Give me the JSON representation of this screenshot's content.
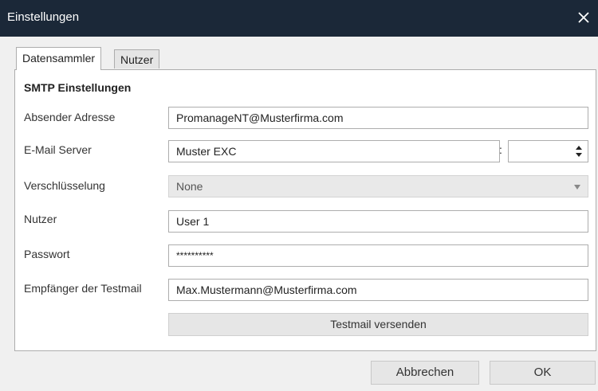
{
  "window": {
    "title": "Einstellungen"
  },
  "tabs": [
    {
      "label": "Datensammler"
    },
    {
      "label": "Nutzer"
    }
  ],
  "section_title": "SMTP Einstellungen",
  "fields": {
    "sender": {
      "label": "Absender Adresse",
      "value": "PromanageNT@Musterfirma.com"
    },
    "server": {
      "label": "E-Mail Server",
      "value": "Muster EXC",
      "port": ""
    },
    "encryption": {
      "label": "Verschlüsselung",
      "value": "None"
    },
    "user": {
      "label": "Nutzer",
      "value": "User 1"
    },
    "password": {
      "label": "Passwort",
      "value": "**********"
    },
    "recipient": {
      "label": "Empfänger der Testmail",
      "value": "Max.Mustermann@Musterfirma.com"
    }
  },
  "buttons": {
    "test": "Testmail versenden",
    "cancel": "Abbrechen",
    "ok": "OK"
  },
  "server_separator": ":",
  "colors": {
    "titlebar": "#1b2838",
    "background": "#f0f0f0",
    "panel": "#ffffff"
  }
}
